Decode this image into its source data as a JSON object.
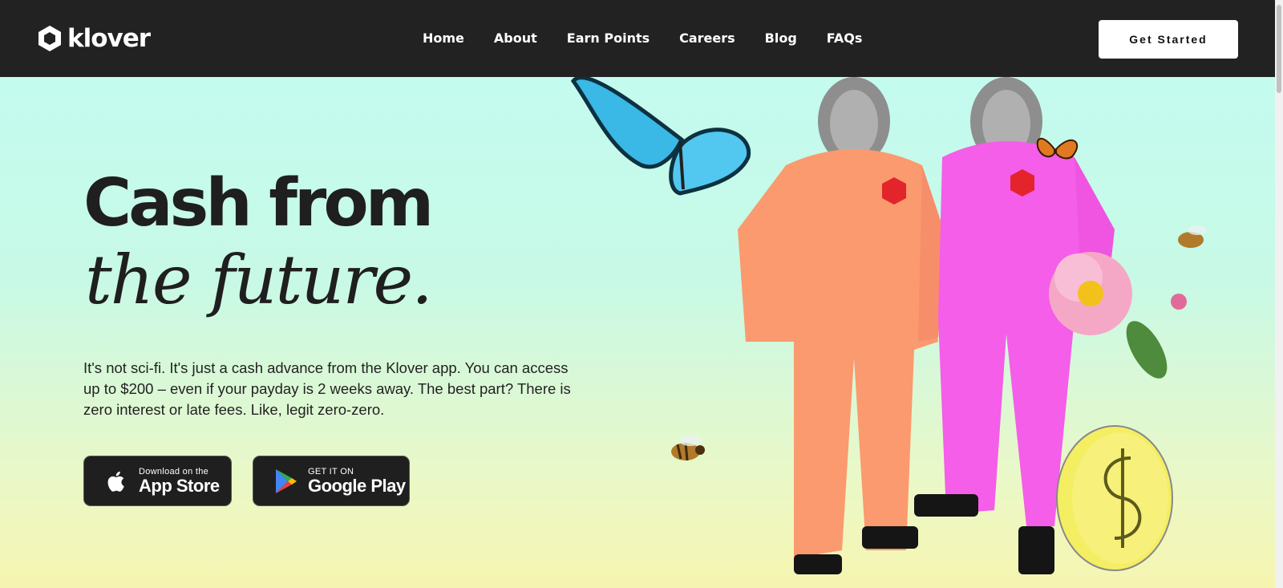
{
  "brand": {
    "name": "klover"
  },
  "nav": {
    "items": [
      {
        "label": "Home"
      },
      {
        "label": "About"
      },
      {
        "label": "Earn Points"
      },
      {
        "label": "Careers"
      },
      {
        "label": "Blog"
      },
      {
        "label": "FAQs"
      }
    ],
    "cta_label": "Get Started"
  },
  "hero": {
    "headline_line1": "Cash from",
    "headline_line2": "the future.",
    "description": "It's not sci-fi. It's just a cash advance from the Klover app. You can access up to $200 – even if your payday is 2 weeks away. The best part? There is zero interest or late fees. Like, legit zero-zero.",
    "app_store": {
      "small": "Download on the",
      "big": "App Store"
    },
    "google_play": {
      "small": "GET IT ON",
      "big": "Google Play"
    }
  },
  "colors": {
    "navbar": "#222222",
    "hero_top": "#c3fbef",
    "hero_bottom": "#f6f5b0",
    "suit_orange": "#fb9a6e",
    "suit_pink": "#f45ee8",
    "coin": "#f4ee63"
  },
  "icons": [
    "klover-logo-icon",
    "apple-icon",
    "google-play-icon",
    "butterfly-icon",
    "bee-icon",
    "flower-icon",
    "coin-icon"
  ]
}
